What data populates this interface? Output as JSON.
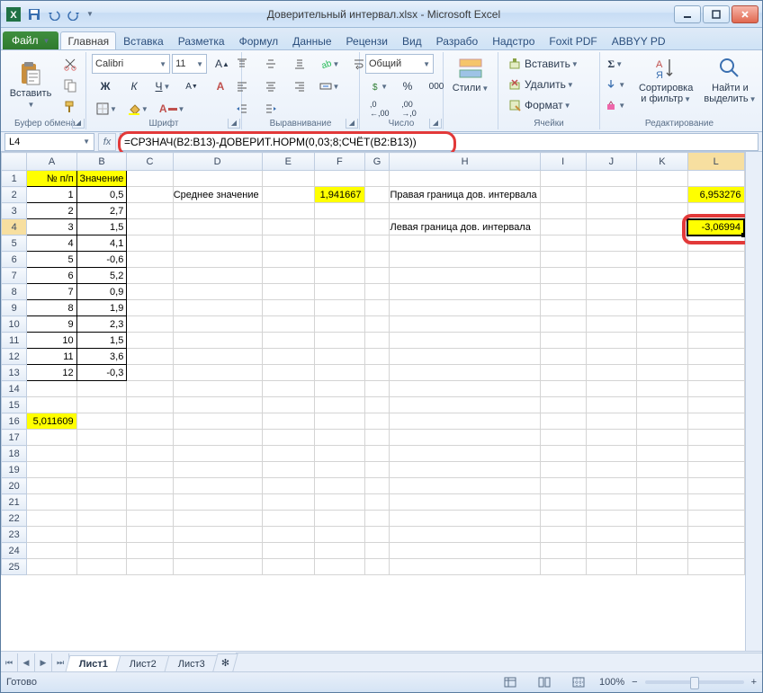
{
  "window": {
    "title": "Доверительный интервал.xlsx - Microsoft Excel"
  },
  "tabs": {
    "file": "Файл",
    "items": [
      "Главная",
      "Вставка",
      "Разметка",
      "Формул",
      "Данные",
      "Рецензи",
      "Вид",
      "Разрабо",
      "Надстро",
      "Foxit PDF",
      "ABBYY PD"
    ],
    "active": 0
  },
  "ribbon": {
    "clipboard": {
      "label": "Буфер обмена",
      "paste": "Вставить"
    },
    "font": {
      "label": "Шрифт",
      "name": "Calibri",
      "size": "11"
    },
    "alignment": {
      "label": "Выравнивание"
    },
    "number": {
      "label": "Число",
      "format": "Общий"
    },
    "styles": {
      "label": "",
      "btn": "Стили"
    },
    "cells": {
      "label": "Ячейки",
      "insert": "Вставить",
      "delete": "Удалить",
      "format": "Формат"
    },
    "editing": {
      "label": "Редактирование",
      "sort": "Сортировка и фильтр",
      "find": "Найти и выделить"
    }
  },
  "subribbon": {
    "namebox": "L4",
    "formula": "=СРЗНАЧ(B2:B13)-ДОВЕРИТ.НОРМ(0,03;8;СЧЁТ(B2:B13))"
  },
  "columns": [
    "A",
    "B",
    "C",
    "D",
    "E",
    "F",
    "G",
    "H",
    "I",
    "J",
    "K",
    "L"
  ],
  "headers": {
    "a": "№ п/п",
    "b": "Значение"
  },
  "table": [
    {
      "n": "1",
      "v": "0,5"
    },
    {
      "n": "2",
      "v": "2,7"
    },
    {
      "n": "3",
      "v": "1,5"
    },
    {
      "n": "4",
      "v": "4,1"
    },
    {
      "n": "5",
      "v": "-0,6"
    },
    {
      "n": "6",
      "v": "5,2"
    },
    {
      "n": "7",
      "v": "0,9"
    },
    {
      "n": "8",
      "v": "1,9"
    },
    {
      "n": "9",
      "v": "2,3"
    },
    {
      "n": "10",
      "v": "1,5"
    },
    {
      "n": "11",
      "v": "3,6"
    },
    {
      "n": "12",
      "v": "-0,3"
    }
  ],
  "labels": {
    "mean": "Среднее значение",
    "right": "Правая граница дов. интервала",
    "left": "Левая граница дов. интервала"
  },
  "values": {
    "mean": "1,941667",
    "right": "6,953276",
    "left": "-3,06994",
    "extra": "5,011609"
  },
  "sheets": {
    "items": [
      "Лист1",
      "Лист2",
      "Лист3"
    ],
    "active": 0
  },
  "status": {
    "ready": "Готово",
    "zoom": "100%"
  }
}
